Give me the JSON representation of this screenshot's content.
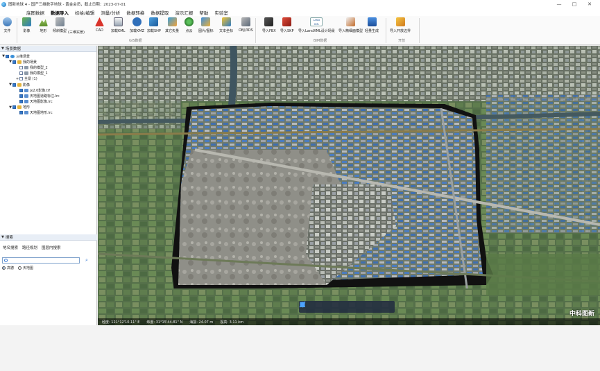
{
  "titlebar": {
    "title": "图新地球 4 - 国产三维数字地球 - 黄金会员，截止日期：2023-07-01",
    "controls": [
      "—",
      "□",
      "✕"
    ]
  },
  "menubar": {
    "items": [
      "底图数据",
      "数据导入",
      "标绘/编辑",
      "测量/分析",
      "数据转换",
      "数据提取",
      "演示汇报",
      "帮助",
      "实验室"
    ]
  },
  "ribbon": {
    "file": "文件",
    "gis_buttons": [
      "影像",
      "地形",
      "倾斜模型",
      "(三维实景)",
      "CAD",
      "加载KML",
      "加载KMZ",
      "加载SHP",
      "其它矢量",
      "点云",
      "图片/图标",
      "文本坐标",
      "OBJ/3DS"
    ],
    "bim_buttons": [
      "导入FBX",
      "导入SKP",
      "导入LandXML设计场景",
      "导入精细面模型",
      "轻量生成"
    ],
    "dev_buttons": [
      "导入开放边界"
    ],
    "group_gis": "GIS数据",
    "group_bim": "BIM数据",
    "group_dev": "开放",
    "landxml_badge": "LAND XML"
  },
  "layers_panel": {
    "header": "场景数据",
    "nodes": [
      {
        "label": "三维场景",
        "level": 0,
        "exp": "▼",
        "checked": true,
        "icon": "globe"
      },
      {
        "label": "我的场景",
        "level": 1,
        "exp": "▼",
        "checked": true,
        "icon": "folder"
      },
      {
        "label": "我的模型_2",
        "level": 2,
        "exp": "",
        "checked": false,
        "icon": "model"
      },
      {
        "label": "我的模型_1",
        "level": 2,
        "exp": "",
        "checked": false,
        "icon": "model"
      },
      {
        "label": "全景 (1)",
        "level": 2,
        "exp": "+",
        "checked": false,
        "icon": "none"
      },
      {
        "label": "影像",
        "level": 1,
        "exp": "▼",
        "checked": true,
        "icon": "folder"
      },
      {
        "label": "jx2.0影像.tif",
        "level": 2,
        "exp": "",
        "checked": true,
        "icon": "image"
      },
      {
        "label": "天地图道路标注.lrc",
        "level": 2,
        "exp": "",
        "checked": true,
        "icon": "image"
      },
      {
        "label": "天地图影像.lrc",
        "level": 2,
        "exp": "",
        "checked": true,
        "icon": "image"
      },
      {
        "label": "地形",
        "level": 1,
        "exp": "▼",
        "checked": true,
        "icon": "folder"
      },
      {
        "label": "天地图地形.lrc",
        "level": 2,
        "exp": "",
        "checked": true,
        "icon": "image"
      }
    ]
  },
  "search_panel": {
    "header": "搜索",
    "tabs": [
      "地名搜索",
      "路径规划",
      "图层内搜索"
    ],
    "search_value": "",
    "radios": [
      {
        "label": "高德",
        "selected": true
      },
      {
        "label": "天地图",
        "selected": false
      }
    ]
  },
  "map": {
    "watermark": "中科图新",
    "status": [
      "经度: 121°12'10.11\" E",
      "纬度: 31°15'44.81\" N",
      "海拔: 24.07 m",
      "视高: 3.11 km"
    ],
    "tools": [
      "hand-icon",
      "pointer-icon",
      "pin-icon",
      "line-icon",
      "polygon-icon",
      "measure-icon"
    ]
  }
}
